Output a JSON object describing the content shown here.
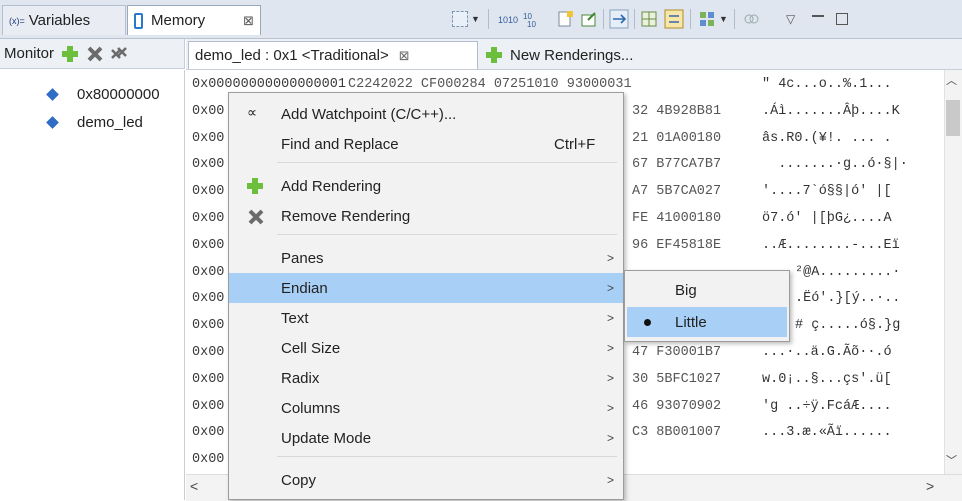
{
  "top_tabs": {
    "variables": {
      "prefix": "(x)=",
      "label": "Variables"
    },
    "memory": {
      "label": "Memory",
      "close": "⊠"
    }
  },
  "toolbar": {
    "icons": [
      "new-memory-view-icon",
      "binary-1010-icon",
      "binary-1010-alt-icon",
      "new-page-icon",
      "export-icon",
      "link-icon",
      "grid-icon",
      "toggle-split-icon",
      "layout-icon",
      "pin-icon",
      "view-menu-icon",
      "minimize-icon",
      "maximize-icon"
    ]
  },
  "monitor": {
    "label": "Monitor",
    "items": [
      {
        "label": "0x80000000"
      },
      {
        "label": "demo_led"
      }
    ]
  },
  "rendering_tabs": {
    "active": {
      "label": "demo_led : 0x1 <Traditional>",
      "close": "⊠"
    },
    "new": {
      "label": "New Renderings..."
    }
  },
  "memory": {
    "rows": [
      {
        "addr": "0x00000000000000001",
        "hex": "C2242022 CF000284 07251010 93000031",
        "ascii": "\" 4c...o..%.1..."
      },
      {
        "addr": "0x00",
        "hex": "32 4B928B81",
        "ascii": ".Áì.......Âþ....K"
      },
      {
        "addr": "0x00",
        "hex": "21 01A00180",
        "ascii": "âs.R0.(¥!. ... ."
      },
      {
        "addr": "0x00",
        "hex": "67 B77CA7B7",
        "ascii": "  .......·g..ó·§|·"
      },
      {
        "addr": "0x00",
        "hex": "A7 5B7CA027",
        "ascii": "'....7`ó§§|ó' |["
      },
      {
        "addr": "0x00",
        "hex": "FE 41000180",
        "ascii": "ö7.ó' |[þG¿....A"
      },
      {
        "addr": "0x00",
        "hex": "96 EF45818E",
        "ascii": "..Æ........-...Eï"
      },
      {
        "addr": "0x00",
        "hex": "",
        "ascii": "²@A.........·"
      },
      {
        "addr": "0x00",
        "hex": "",
        "ascii": ".Ëó'.}[ý..·.."
      },
      {
        "addr": "0x00",
        "hex": "",
        "ascii": "# ç.....ó§.}g"
      },
      {
        "addr": "0x00",
        "hex": "47 F30001B7",
        "ascii": "...·..ä.G.Ãõ··.ó"
      },
      {
        "addr": "0x00",
        "hex": "30 5BFC1027",
        "ascii": "w.0¡..§...çs'.ü["
      },
      {
        "addr": "0x00",
        "hex": "46 93070902",
        "ascii": "'g ..÷ÿ.FcáÆ...."
      },
      {
        "addr": "0x00",
        "hex": "C3 8B001007",
        "ascii": "...3.æ.«Ãï......"
      },
      {
        "addr": "0x00",
        "hex": "",
        "ascii": ""
      }
    ]
  },
  "context_menu": {
    "items": [
      {
        "label": "Add Watchpoint (C/C++)...",
        "shortcut": "",
        "submenu": false,
        "icon": "watchpoint-icon"
      },
      {
        "label": "Find and Replace",
        "shortcut": "Ctrl+F",
        "submenu": false,
        "icon": ""
      },
      {
        "label": "Add Rendering",
        "shortcut": "",
        "submenu": false,
        "icon": "add-icon"
      },
      {
        "label": "Remove Rendering",
        "shortcut": "",
        "submenu": false,
        "icon": "remove-icon"
      },
      {
        "label": "Panes",
        "shortcut": "",
        "submenu": true,
        "icon": ""
      },
      {
        "label": "Endian",
        "shortcut": "",
        "submenu": true,
        "icon": "",
        "highlighted": true
      },
      {
        "label": "Text",
        "shortcut": "",
        "submenu": true,
        "icon": ""
      },
      {
        "label": "Cell Size",
        "shortcut": "",
        "submenu": true,
        "icon": ""
      },
      {
        "label": "Radix",
        "shortcut": "",
        "submenu": true,
        "icon": ""
      },
      {
        "label": "Columns",
        "shortcut": "",
        "submenu": true,
        "icon": ""
      },
      {
        "label": "Update Mode",
        "shortcut": "",
        "submenu": true,
        "icon": ""
      },
      {
        "label": "Copy",
        "shortcut": "",
        "submenu": true,
        "icon": ""
      }
    ],
    "chevron": ">"
  },
  "endian_submenu": {
    "items": [
      {
        "label": "Big",
        "selected": false
      },
      {
        "label": "Little",
        "selected": true
      }
    ]
  },
  "colors": {
    "highlight": "#a8d0f6",
    "accent": "#2e6cc5",
    "add_green": "#6cbf3d"
  }
}
